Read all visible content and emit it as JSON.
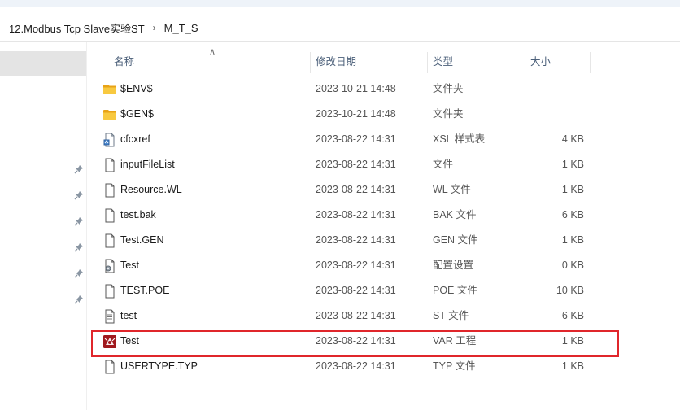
{
  "breadcrumb": {
    "items": [
      "12.Modbus Tcp Slave实验ST",
      "M_T_S"
    ],
    "separator": "›"
  },
  "columns": {
    "name": "名称",
    "date": "修改日期",
    "type": "类型",
    "size": "大小"
  },
  "files": [
    {
      "name": "$ENV$",
      "date": "2023-10-21 14:48",
      "type": "文件夹",
      "size": "",
      "icon": "folder-icon"
    },
    {
      "name": "$GEN$",
      "date": "2023-10-21 14:48",
      "type": "文件夹",
      "size": "",
      "icon": "folder-icon"
    },
    {
      "name": "cfcxref",
      "date": "2023-08-22 14:31",
      "type": "XSL 样式表",
      "size": "4 KB",
      "icon": "xsl-file-icon"
    },
    {
      "name": "inputFileList",
      "date": "2023-08-22 14:31",
      "type": "文件",
      "size": "1 KB",
      "icon": "file-icon"
    },
    {
      "name": "Resource.WL",
      "date": "2023-08-22 14:31",
      "type": "WL 文件",
      "size": "1 KB",
      "icon": "file-icon"
    },
    {
      "name": "test.bak",
      "date": "2023-08-22 14:31",
      "type": "BAK 文件",
      "size": "6 KB",
      "icon": "file-icon"
    },
    {
      "name": "Test.GEN",
      "date": "2023-08-22 14:31",
      "type": "GEN 文件",
      "size": "1 KB",
      "icon": "file-icon"
    },
    {
      "name": "Test",
      "date": "2023-08-22 14:31",
      "type": "配置设置",
      "size": "0 KB",
      "icon": "settings-file-icon"
    },
    {
      "name": "TEST.POE",
      "date": "2023-08-22 14:31",
      "type": "POE 文件",
      "size": "10 KB",
      "icon": "file-icon"
    },
    {
      "name": "test",
      "date": "2023-08-22 14:31",
      "type": "ST 文件",
      "size": "6 KB",
      "icon": "text-file-icon"
    },
    {
      "name": "Test",
      "date": "2023-08-22 14:31",
      "type": "VAR 工程",
      "size": "1 KB",
      "icon": "var-project-icon"
    },
    {
      "name": "USERTYPE.TYP",
      "date": "2023-08-22 14:31",
      "type": "TYP 文件",
      "size": "1 KB",
      "icon": "file-icon"
    }
  ],
  "highlighted_row": "Test (VAR 工程)",
  "colors": {
    "folder": "#f4c430",
    "highlight_border": "#e0262b",
    "header_text": "#4c607a",
    "var_icon": "#a0191e"
  }
}
